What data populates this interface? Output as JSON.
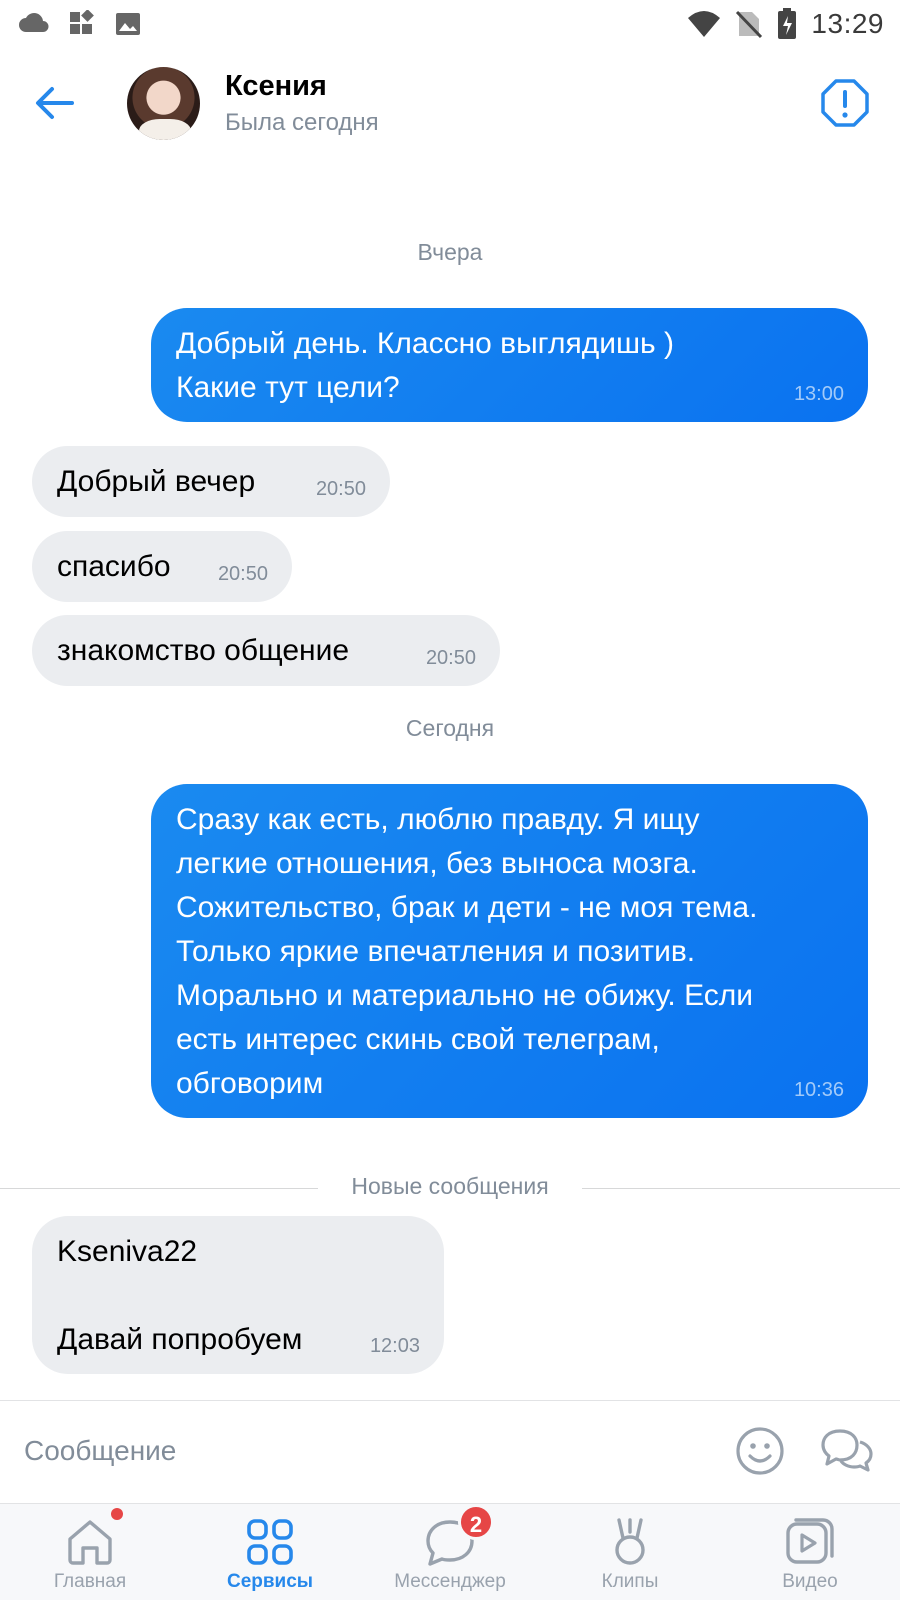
{
  "status_bar": {
    "time": "13:29"
  },
  "header": {
    "contact_name": "Ксения",
    "contact_status": "Была сегодня"
  },
  "chat": {
    "date_yesterday": "Вчера",
    "msg1": {
      "line1": "Добрый день. Классно выглядишь )",
      "line2": "Какие тут цели?",
      "time": "13:00"
    },
    "msg2": {
      "text": "Добрый вечер",
      "time": "20:50"
    },
    "msg3": {
      "text": "спасибо",
      "time": "20:50"
    },
    "msg4": {
      "text": "знакомство общение",
      "time": "20:50"
    },
    "date_today": "Сегодня",
    "msg5": {
      "lines": [
        "Сразу как есть, люблю правду. Я ищу",
        "легкие отношения, без выноса мозга.",
        "Сожительство, брак и дети - не моя тема.",
        "Только яркие впечатления и позитив.",
        "Морально и материально не обижу. Если",
        "есть интерес скинь свой телеграм,",
        "обговорим"
      ],
      "time": "10:36"
    },
    "new_messages_label": "Новые сообщения",
    "msg6": {
      "line1": "Kseniva22",
      "line2": "Давай попробуем",
      "time": "12:03"
    }
  },
  "composer": {
    "placeholder": "Сообщение"
  },
  "tabbar": {
    "tabs": [
      {
        "label": "Главная",
        "icon": "home-icon"
      },
      {
        "label": "Сервисы",
        "icon": "services-icon"
      },
      {
        "label": "Мессенджер",
        "icon": "messenger-icon",
        "badge": "2"
      },
      {
        "label": "Клипы",
        "icon": "clips-icon"
      },
      {
        "label": "Видео",
        "icon": "video-icon"
      }
    ],
    "active_tab": "Сервисы"
  },
  "colors": {
    "accent": "#2688eb",
    "outgoing_bubble": "#0a72f0",
    "incoming_bubble": "#ebedf0",
    "badge": "#e64646"
  }
}
